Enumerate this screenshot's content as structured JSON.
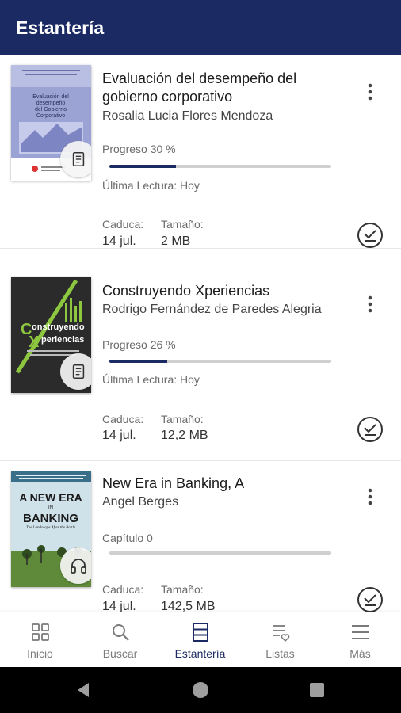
{
  "app_bar": {
    "title": "Estantería"
  },
  "books": [
    {
      "title": "Evaluación del desempeño del gobierno corporativo",
      "author": "Rosalia Lucia  Flores Mendoza",
      "progress_label": "Progreso 30 %",
      "progress": 0.3,
      "last_read": "Última Lectura: Hoy",
      "expiry_label": "Caduca:",
      "expiry": "14 jul.",
      "size_label": "Tamaño:",
      "size": "2 MB",
      "format_icon": "document-icon",
      "cover": {
        "line1": "Evaluación del",
        "line2": "desempeño",
        "line3": "del Gobierno",
        "line4": "Corporativo"
      }
    },
    {
      "title": "Construyendo Xperiencias",
      "author": "Rodrigo Fernández de Paredes Alegria",
      "progress_label": "Progreso 26 %",
      "progress": 0.26,
      "last_read": "Última Lectura: Hoy",
      "expiry_label": "Caduca:",
      "expiry": "14 jul.",
      "size_label": "Tamaño:",
      "size": "12,2 MB",
      "format_icon": "document-icon",
      "cover": {
        "line1": "onstruyendo",
        "line2": "periencias"
      }
    },
    {
      "title": "New Era in Banking, A",
      "author": "Angel Berges",
      "progress_label": "Capítulo 0",
      "progress": 0,
      "last_read": "",
      "expiry_label": "Caduca:",
      "expiry": "14 jul.",
      "size_label": "Tamaño:",
      "size": "142,5 MB",
      "format_icon": "headphones-icon",
      "cover": {
        "line1": "A NEW ERA",
        "line2": "IN",
        "line3": "BANKING",
        "line4": "The Landscape After the Battle"
      }
    }
  ],
  "bottom_nav": [
    {
      "label": "Inicio",
      "icon": "grid-icon",
      "active": false
    },
    {
      "label": "Buscar",
      "icon": "search-icon",
      "active": false
    },
    {
      "label": "Estantería",
      "icon": "bookshelf-icon",
      "active": true
    },
    {
      "label": "Listas",
      "icon": "list-heart-icon",
      "active": false
    },
    {
      "label": "Más",
      "icon": "menu-icon",
      "active": false
    }
  ],
  "colors": {
    "primary": "#1b2a63",
    "accent_green": "#8dc63f",
    "text_muted": "#6b6b6b"
  }
}
